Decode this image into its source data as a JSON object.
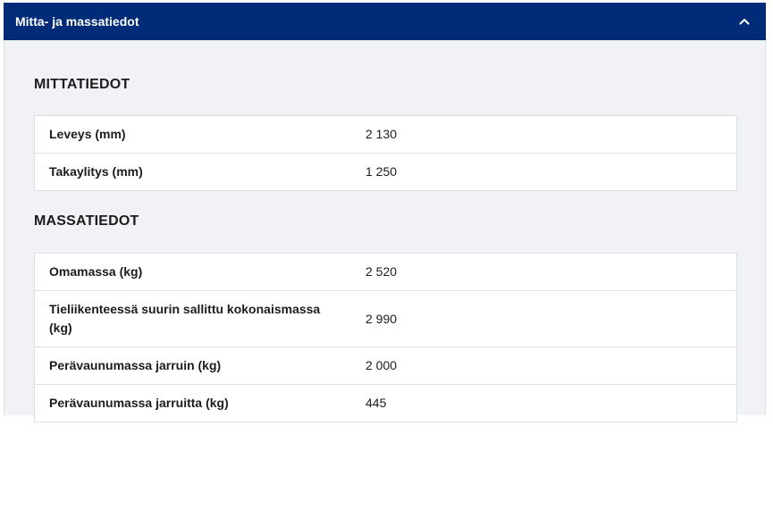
{
  "accordion": {
    "title": "Mitta- ja massatiedot",
    "toggle_icon": "chevron-up-icon"
  },
  "dimensions": {
    "heading": "MITTATIEDOT",
    "rows": [
      {
        "label": "Leveys (mm)",
        "value": "2 130"
      },
      {
        "label": "Takaylitys (mm)",
        "value": "1 250"
      }
    ]
  },
  "masses": {
    "heading": "MASSATIEDOT",
    "rows": [
      {
        "label": "Omamassa (kg)",
        "value": "2 520"
      },
      {
        "label": "Tieliikenteessä suurin sallittu kokonaismassa (kg)",
        "value": "2 990"
      },
      {
        "label": "Perävaunumassa jarruin (kg)",
        "value": "2 000"
      },
      {
        "label": "Perävaunumassa jarruitta (kg)",
        "value": "445"
      }
    ]
  },
  "colors": {
    "header_bg": "#002b78",
    "body_bg": "#f1f2f5"
  }
}
